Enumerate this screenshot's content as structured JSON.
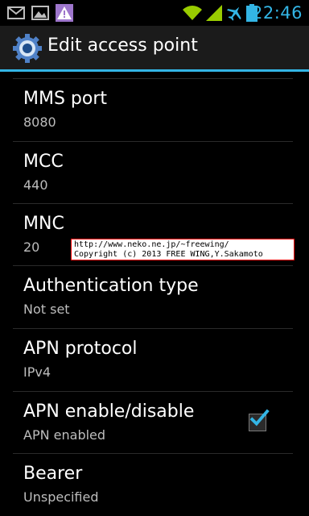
{
  "status_bar": {
    "time": "22:46",
    "icons": [
      "gmail-icon",
      "image-icon",
      "warning-icon",
      "wifi-icon",
      "signal-icon",
      "airplane-icon",
      "battery-icon"
    ]
  },
  "action_bar": {
    "title": "Edit access point",
    "icon": "settings-gear-icon"
  },
  "preferences": [
    {
      "title": "MMS port",
      "summary": "8080"
    },
    {
      "title": "MCC",
      "summary": "440"
    },
    {
      "title": "MNC",
      "summary": "20"
    },
    {
      "title": "Authentication type",
      "summary": "Not set"
    },
    {
      "title": "APN protocol",
      "summary": "IPv4"
    },
    {
      "title": "APN enable/disable",
      "summary": "APN enabled",
      "checked": true
    },
    {
      "title": "Bearer",
      "summary": "Unspecified"
    }
  ],
  "watermark": {
    "line1": "http://www.neko.ne.jp/~freewing/",
    "line2": "Copyright (c) 2013 FREE WING,Y.Sakamoto"
  },
  "colors": {
    "accent": "#33b5e5",
    "background": "#000000",
    "action_bar": "#1b1b1b",
    "wifi_signal": "#99cc00"
  }
}
